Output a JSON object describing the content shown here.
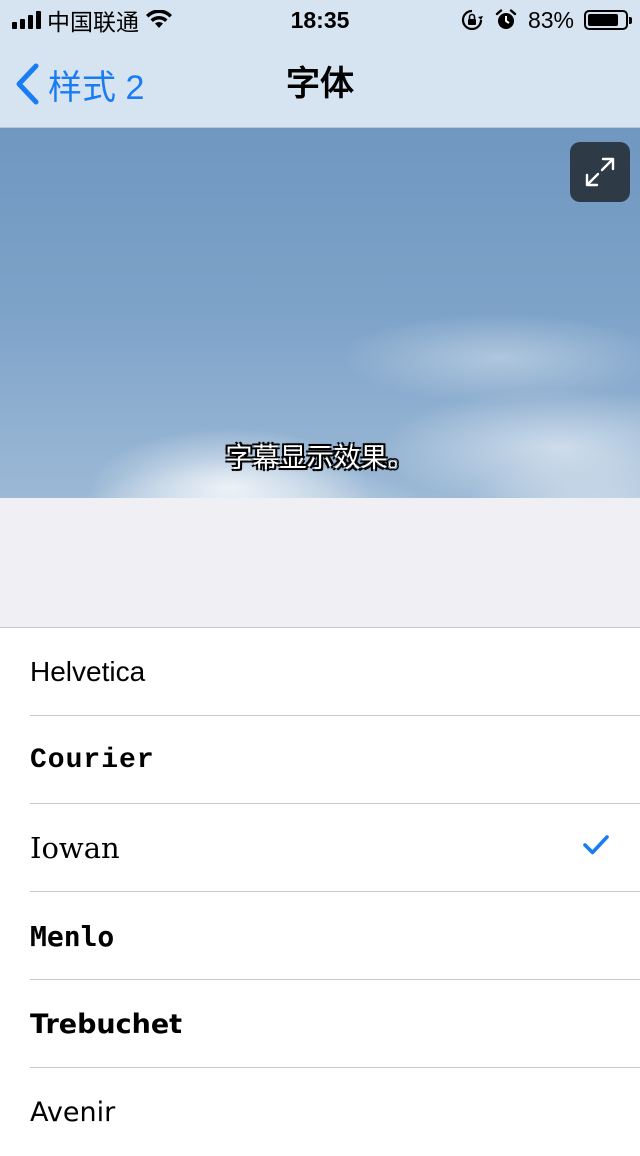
{
  "status_bar": {
    "carrier": "中国联通",
    "time": "18:35",
    "battery_percent": "83%",
    "battery_level": 0.83,
    "icons": [
      "signal-icon",
      "wifi-icon",
      "orientation-lock-icon",
      "alarm-icon",
      "battery-icon"
    ]
  },
  "nav": {
    "back_label": "样式 2",
    "title": "字体"
  },
  "preview": {
    "subtitle_text": "字幕显示效果。",
    "expand_icon": "expand-icon"
  },
  "fonts": {
    "items": [
      {
        "label": "Helvetica",
        "selected": false
      },
      {
        "label": "Courier",
        "selected": false
      },
      {
        "label": "Iowan",
        "selected": true
      },
      {
        "label": "Menlo",
        "selected": false
      },
      {
        "label": "Trebuchet",
        "selected": false
      },
      {
        "label": "Avenir",
        "selected": false
      }
    ]
  },
  "colors": {
    "accent": "#1a7cf2",
    "nav_background": "#d6e4f2",
    "group_background": "#efeff4"
  }
}
